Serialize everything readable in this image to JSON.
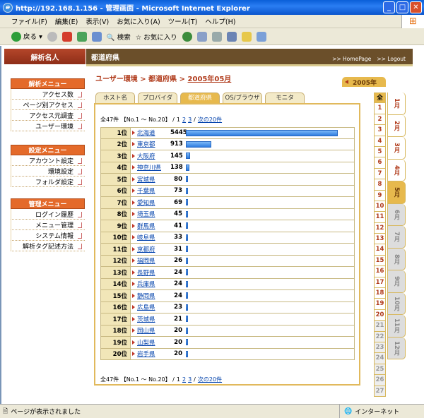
{
  "window": {
    "title": "http://192.168.1.156 - 管理画面 - Microsoft Internet Explorer"
  },
  "menubar": [
    "ファイル(F)",
    "編集(E)",
    "表示(V)",
    "お気に入り(A)",
    "ツール(T)",
    "ヘルプ(H)"
  ],
  "toolbar": {
    "back": "戻る",
    "search": "検索",
    "favorites": "お気に入り"
  },
  "header": {
    "logo": "解析名人",
    "page_title": "都道府県",
    "homepage": ">> HomePage",
    ">logout": "",
    "logout": ">> Logout"
  },
  "sidebar": {
    "analysis_head": "解析メニュー",
    "analysis": [
      "アクセス数",
      "ページ別アクセス",
      "アクセス元調査",
      "ユーザー環境"
    ],
    "settings_head": "設定メニュー",
    "settings": [
      "アカウント設定",
      "環境設定",
      "フォルダ設定"
    ],
    "admin_head": "管理メニュー",
    "admin": [
      "ログイン履歴",
      "メニュー管理",
      "システム情報",
      "解析タグ記述方法"
    ]
  },
  "breadcrumb": {
    "a": "ユーザー環境",
    "sep1": ">",
    "b": "都道府県",
    "sep2": ">",
    "c": "2005年05月"
  },
  "tabs": [
    "ホスト名",
    "プロバイダ",
    "都道府県",
    "OS/ブラウザ",
    "モニタ"
  ],
  "pager": {
    "summary": "全47件 【No.1 〜 No.20】 / ",
    "p1": "1",
    "p2": "2",
    "p3": "3",
    "slash": "/",
    "next": "次の20件"
  },
  "chart_data": {
    "type": "bar",
    "categories": [
      "北海道",
      "東京都",
      "大阪府",
      "神奈川県",
      "宮城県",
      "千葉県",
      "愛知県",
      "埼玉県",
      "群馬県",
      "岐阜県",
      "京都府",
      "福岡県",
      "長野県",
      "兵庫県",
      "静岡県",
      "広島県",
      "茨城県",
      "岡山県",
      "山梨県",
      "岩手県"
    ],
    "ranks": [
      "1位",
      "2位",
      "3位",
      "4位",
      "5位",
      "6位",
      "7位",
      "8位",
      "9位",
      "10位",
      "11位",
      "12位",
      "13位",
      "14位",
      "15位",
      "16位",
      "17位",
      "18位",
      "19位",
      "20位"
    ],
    "values": [
      5445,
      913,
      145,
      138,
      80,
      73,
      69,
      45,
      41,
      33,
      31,
      26,
      24,
      24,
      24,
      23,
      21,
      20,
      20,
      20
    ],
    "max": 5445
  },
  "calendar": {
    "year": "2005年",
    "days": [
      "全",
      "1",
      "2",
      "3",
      "4",
      "5",
      "6",
      "7",
      "8",
      "9",
      "10",
      "11",
      "12",
      "13",
      "14",
      "15",
      "16",
      "17",
      "18",
      "19",
      "20",
      "21",
      "22",
      "23",
      "24",
      "25",
      "26",
      "27"
    ],
    "months": [
      "1月",
      "2月",
      "3月",
      "4月",
      "5月",
      "6月",
      "7月",
      "8月",
      "9月",
      "10月",
      "11月",
      "12月"
    ],
    "selected_month_index": 4,
    "last_active_day": 20
  },
  "statusbar": {
    "left": "ページが表示されました",
    "right": "インターネット"
  }
}
